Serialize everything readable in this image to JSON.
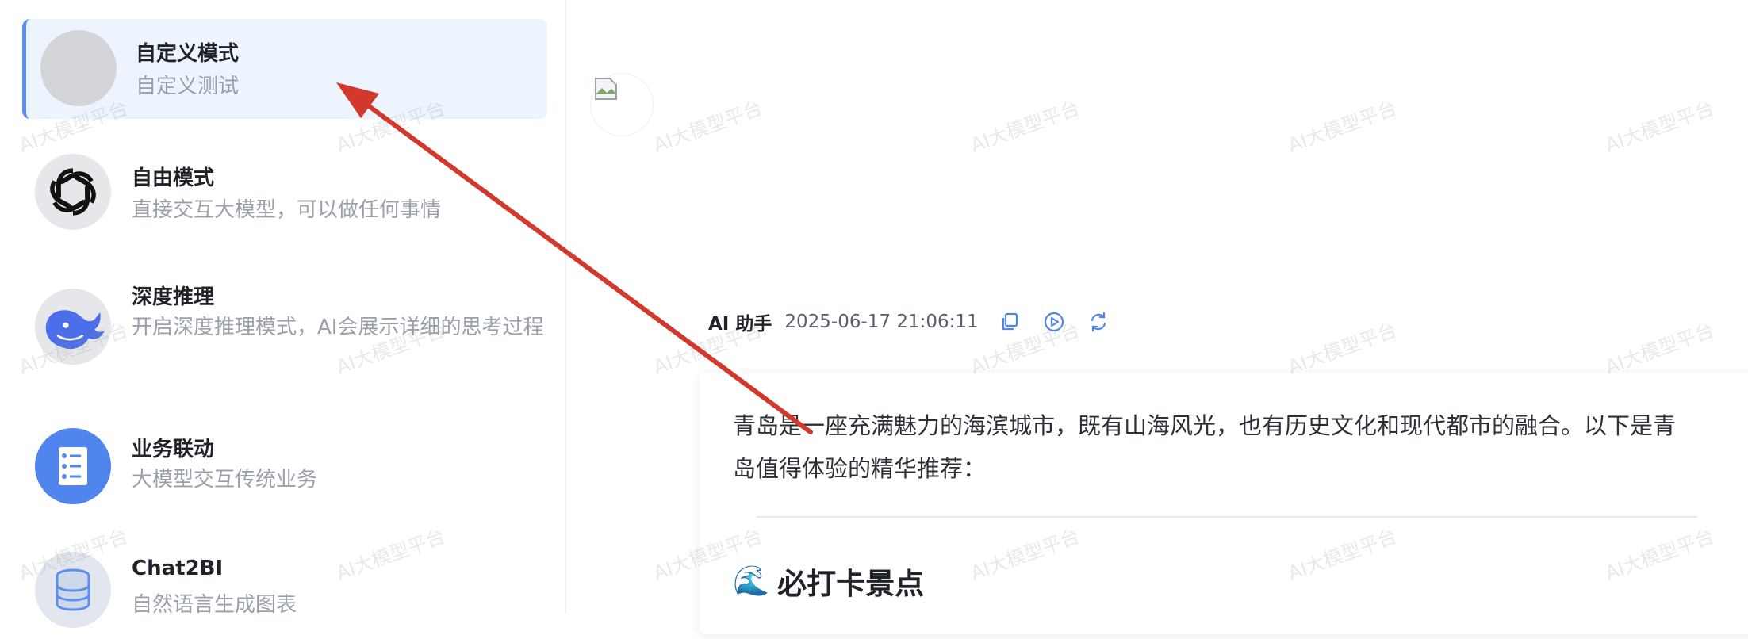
{
  "sidebar": {
    "items": [
      {
        "title": "自定义模式",
        "desc": "自定义测试",
        "active": true
      },
      {
        "title": "自由模式",
        "desc": "直接交互大模型，可以做任何事情"
      },
      {
        "title": "深度推理",
        "desc": "开启深度推理模式，AI会展示详细的思考过程"
      },
      {
        "title": "业务联动",
        "desc": "大模型交互传统业务"
      },
      {
        "title": "Chat2BI",
        "desc": "自然语言生成图表"
      }
    ]
  },
  "chat": {
    "message": {
      "sender": "AI 助手",
      "time": "2025-06-17 21:06:11",
      "actions": [
        "copy-icon",
        "play-icon",
        "refresh-icon"
      ],
      "paragraph": "青岛是一座充满魅力的海滨城市，既有山海风光，也有历史文化和现代都市的融合。以下是青岛值得体验的精华推荐：",
      "section_emoji": "🌊",
      "section_title": "必打卡景点"
    }
  },
  "watermark": {
    "text": "AI大模型平台"
  },
  "colors": {
    "accent": "#5b8ff0",
    "active_bg": "#eef4fd",
    "annotation_arrow": "#d0392b"
  }
}
